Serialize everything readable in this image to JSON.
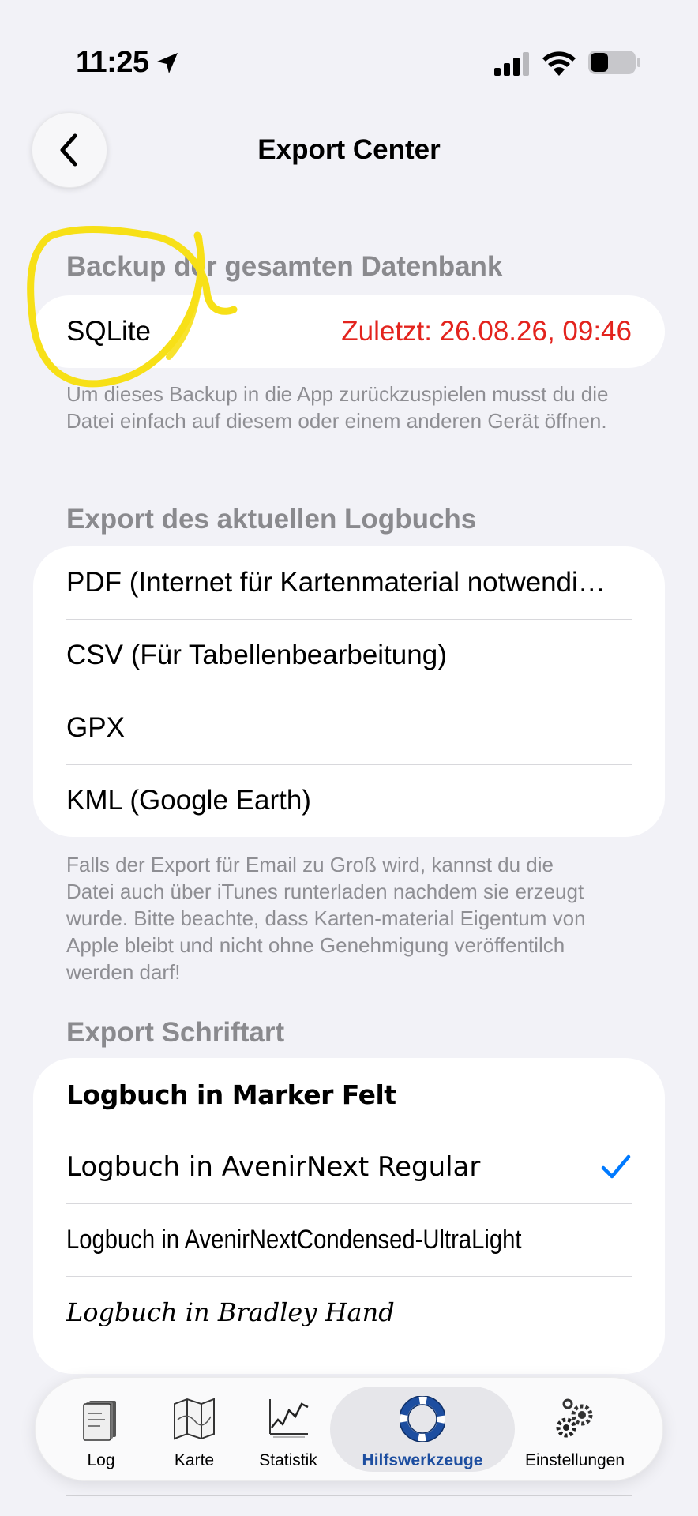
{
  "status_bar": {
    "time": "11:25"
  },
  "nav": {
    "title": "Export Center",
    "back_icon": "chevron-left-icon"
  },
  "backup": {
    "header": "Backup der gesamten Datenbank",
    "row_label": "SQLite",
    "row_value": "Zuletzt: 26.08.26, 09:46",
    "footnote": "Um dieses Backup in die App zurückzuspielen musst du die Datei einfach auf diesem oder einem anderen Gerät öffnen."
  },
  "export": {
    "header": "Export des aktuellen Logbuchs",
    "items": [
      "PDF (Internet für Kartenmaterial notwendi…",
      "CSV (Für Tabellenbearbeitung)",
      "GPX",
      "KML (Google Earth)"
    ],
    "footnote": "Falls der Export für Email zu Groß wird, kannst du die Datei auch über iTunes runterladen nachdem sie erzeugt wurde. Bitte beachte, dass Karten-material Eigentum von Apple bleibt und nicht ohne Genehmigung veröffentilch werden darf!"
  },
  "font": {
    "header": "Export Schriftart",
    "items": [
      "Logbuch in Marker Felt",
      "Logbuch in AvenirNext Regular",
      "Logbuch in AvenirNextCondensed-UltraLight",
      "Logbuch in Bradley Hand"
    ],
    "selected_index": 1
  },
  "tabs": [
    {
      "label": "Log",
      "icon": "logbook-icon"
    },
    {
      "label": "Karte",
      "icon": "map-icon"
    },
    {
      "label": "Statistik",
      "icon": "chart-icon"
    },
    {
      "label": "Hilfswerkzeuge",
      "icon": "lifebuoy-icon",
      "active": true
    },
    {
      "label": "Einstellungen",
      "icon": "gears-icon"
    }
  ],
  "colors": {
    "accent": "#007aff",
    "warning": "#e3231d",
    "active_tab": "#1d4ea0",
    "annotation": "#f7e017"
  }
}
